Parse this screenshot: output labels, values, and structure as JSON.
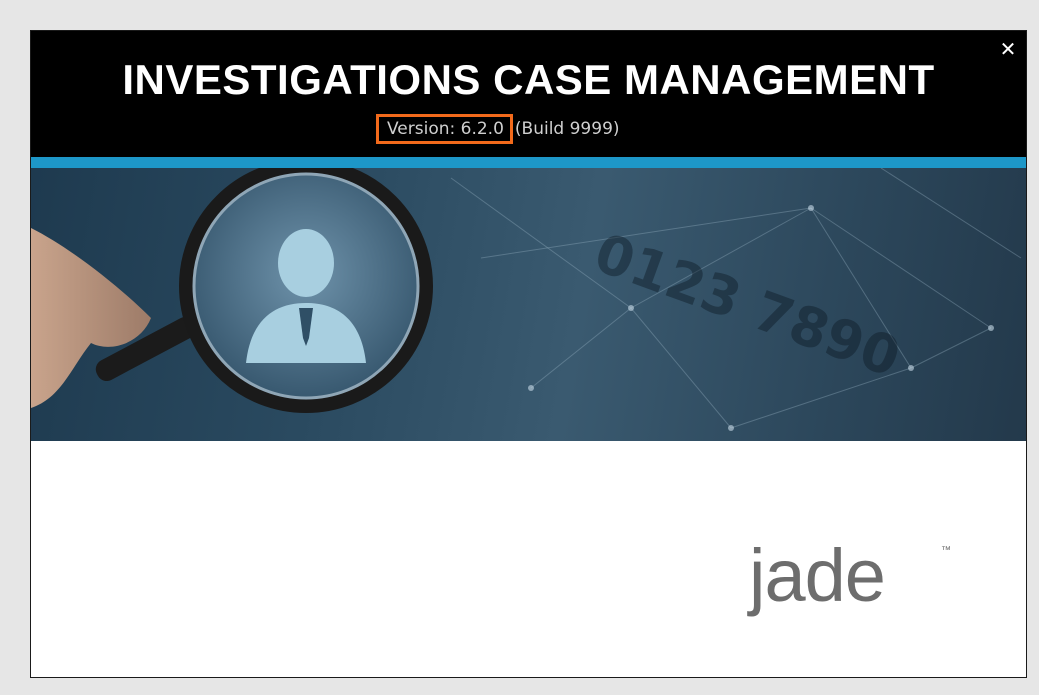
{
  "window": {
    "title": "INVESTIGATIONS CASE MANAGEMENT",
    "version_label": "Version: 6.2.0",
    "build_label": "(Build 9999)",
    "close_glyph": "✕"
  },
  "colors": {
    "header_bg": "#000000",
    "accent_bar": "#1d97c8",
    "highlight_box": "#f26a1b",
    "logo_gray": "#6d6d6d"
  },
  "banner": {
    "icon": "magnifying-glass-person-icon"
  },
  "brand": {
    "logo_text": "jade",
    "trademark": "™"
  }
}
